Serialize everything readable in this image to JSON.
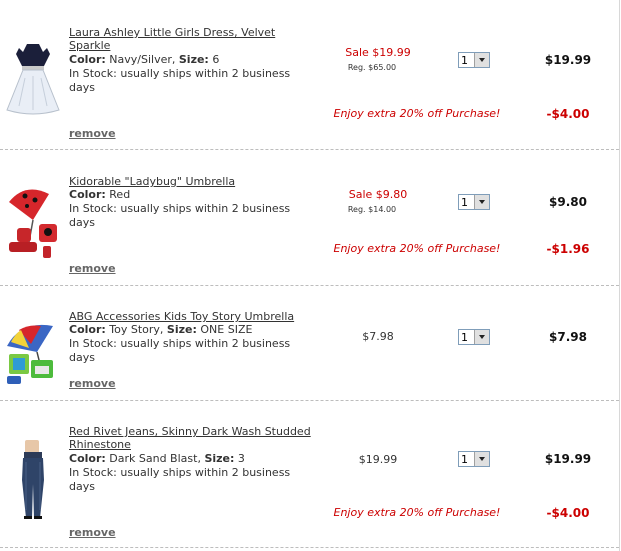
{
  "items": [
    {
      "name": "Laura Ashley Little Girls Dress, Velvet Sparkle",
      "color_label": "Color:",
      "color": "Navy/Silver,",
      "size_label": "Size:",
      "size": "6",
      "stock": "In Stock: usually ships within 2 business days",
      "remove": "remove",
      "sale_price": "Sale $19.99",
      "reg_price": "Reg. $65.00",
      "qty": "1",
      "total": "$19.99",
      "promo": "Enjoy extra 20% off Purchase!",
      "discount": "-$4.00"
    },
    {
      "name": "Kidorable \"Ladybug\" Umbrella",
      "color_label": "Color:",
      "color": "Red",
      "stock": "In Stock: usually ships within 2 business days",
      "remove": "remove",
      "sale_price": "Sale $9.80",
      "reg_price": "Reg. $14.00",
      "qty": "1",
      "total": "$9.80",
      "promo": "Enjoy extra 20% off Purchase!",
      "discount": "-$1.96"
    },
    {
      "name": "ABG Accessories Kids Toy Story Umbrella",
      "color_label": "Color:",
      "color": "Toy Story,",
      "size_label": "Size:",
      "size": "ONE SIZE",
      "stock": "In Stock: usually ships within 2 business days",
      "remove": "remove",
      "price": "$7.98",
      "qty": "1",
      "total": "$7.98"
    },
    {
      "name": "Red Rivet Jeans, Skinny Dark Wash Studded Rhinestone",
      "color_label": "Color:",
      "color": "Dark Sand Blast,",
      "size_label": "Size:",
      "size": "3",
      "stock": "In Stock: usually ships within 2 business days",
      "remove": "remove",
      "price": "$19.99",
      "qty": "1",
      "total": "$19.99",
      "promo": "Enjoy extra 20% off Purchase!",
      "discount": "-$4.00"
    }
  ],
  "colors": {
    "sale_red": "#cc0000",
    "divider": "#bdbdbd"
  }
}
